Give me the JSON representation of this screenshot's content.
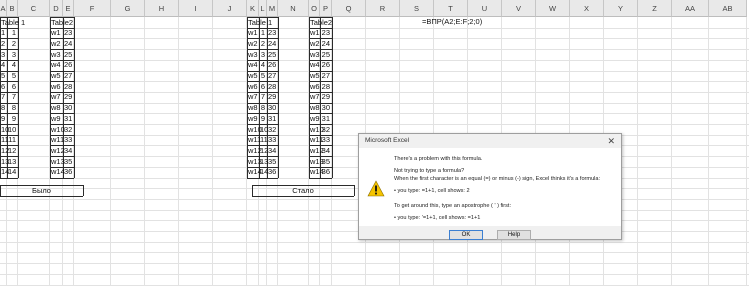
{
  "column_headers": [
    "A",
    "B",
    "C",
    "D",
    "E",
    "F",
    "G",
    "H",
    "I",
    "J",
    "K",
    "L",
    "M",
    "N",
    "O",
    "P",
    "Q",
    "R",
    "S",
    "T",
    "U",
    "V",
    "W",
    "X",
    "Y",
    "Z",
    "AA",
    "AB"
  ],
  "table1_header": "Table 1",
  "table2_header": "Table2",
  "rows": [
    {
      "n": "1",
      "w": "w1",
      "v": "23"
    },
    {
      "n": "2",
      "w": "w2",
      "v": "24"
    },
    {
      "n": "3",
      "w": "w3",
      "v": "25"
    },
    {
      "n": "4",
      "w": "w4",
      "v": "26"
    },
    {
      "n": "5",
      "w": "w5",
      "v": "27"
    },
    {
      "n": "6",
      "w": "w6",
      "v": "28"
    },
    {
      "n": "7",
      "w": "w7",
      "v": "29"
    },
    {
      "n": "8",
      "w": "w8",
      "v": "30"
    },
    {
      "n": "9",
      "w": "w9",
      "v": "31"
    },
    {
      "n": "10",
      "w": "w10",
      "v": "32"
    },
    {
      "n": "11",
      "w": "w11",
      "v": "33"
    },
    {
      "n": "12",
      "w": "w12",
      "v": "34"
    },
    {
      "n": "13",
      "w": "w13",
      "v": "35"
    },
    {
      "n": "14",
      "w": "w14",
      "v": "36"
    }
  ],
  "caption_before": "Было",
  "caption_after": "Стало",
  "formula_text": "=ВПР(A2;E:F;2;0)",
  "dialog": {
    "title": "Microsoft Excel",
    "close_glyph": "✕",
    "line1": "There's a problem with this formula.",
    "line2": "Not trying to type a formula?",
    "line3": "When the first character is an equal (=) or minus (-) sign, Excel thinks it's a formula:",
    "line4": "• you type:   =1+1, cell shows:   2",
    "line5": "To get around this, type an apostrophe ( ' ) first:",
    "line6": "• you type:   '=1+1, cell shows:   =1+1",
    "ok_label": "OK",
    "help_label": "Help",
    "icon": "warning-icon"
  }
}
